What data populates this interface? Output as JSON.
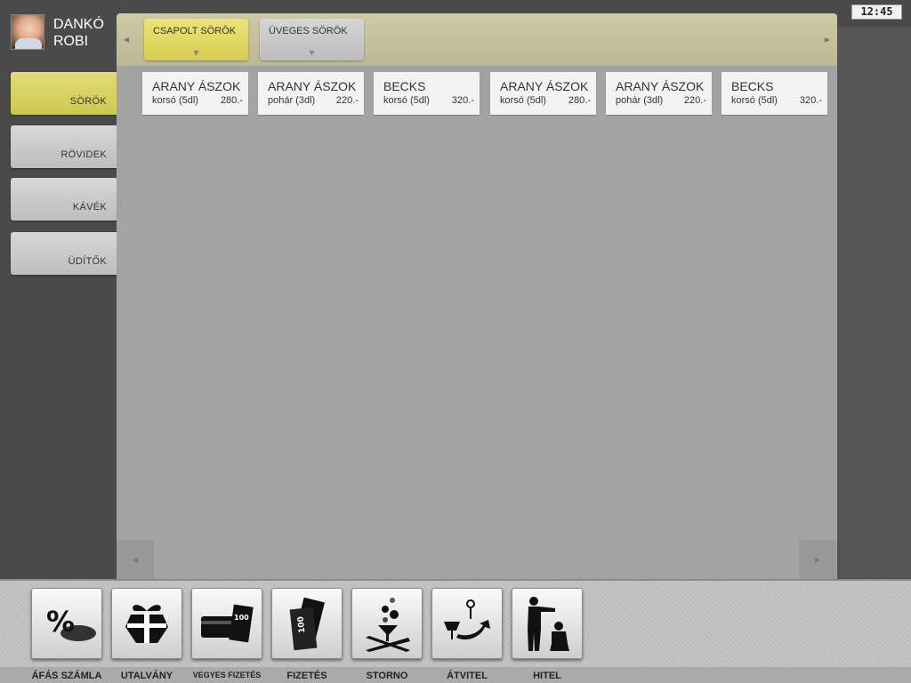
{
  "user": {
    "name_line1": "DANKÓ",
    "name_line2": "ROBI"
  },
  "clock": {
    "time": "12:45"
  },
  "categories": [
    {
      "label": "SÖRÖK",
      "active": true
    },
    {
      "label": "RÖVIDEK",
      "active": false
    },
    {
      "label": "KÁVÉK",
      "active": false
    },
    {
      "label": "ÜDÍTŐK",
      "active": false
    }
  ],
  "sub_tabs": [
    {
      "label": "CSAPOLT SÖRÖK",
      "active": true
    },
    {
      "label": "ÜVEGES SÖRÖK",
      "active": false
    }
  ],
  "products": [
    {
      "name": "ARANY ÁSZOK",
      "size": "korsó (5dl)",
      "price": "280.-"
    },
    {
      "name": "ARANY ÁSZOK",
      "size": "pohár (3dl)",
      "price": "220.-"
    },
    {
      "name": "BECKS",
      "size": "korsó (5dl)",
      "price": "320.-"
    },
    {
      "name": "ARANY ÁSZOK",
      "size": "korsó (5dl)",
      "price": "280.-"
    },
    {
      "name": "ARANY ÁSZOK",
      "size": "pohár (3dl)",
      "price": "220.-"
    },
    {
      "name": "BECKS",
      "size": "korsó (5dl)",
      "price": "320.-"
    }
  ],
  "actions": [
    {
      "label": "ÁFÁS SZÁMLA",
      "icon": "percent-icon"
    },
    {
      "label": "UTALVÁNY",
      "icon": "gift-icon"
    },
    {
      "label": "VEGYES FIZETÉS",
      "icon": "mixed-payment-icon"
    },
    {
      "label": "FIZETÉS",
      "icon": "banknotes-icon"
    },
    {
      "label": "STORNO",
      "icon": "storno-icon"
    },
    {
      "label": "ÁTVITEL",
      "icon": "transfer-icon"
    },
    {
      "label": "HITEL",
      "icon": "credit-icon"
    }
  ],
  "icon_texts": {
    "banknote_value": "100"
  },
  "colors": {
    "accent": "#d6cd52",
    "panel": "#a3a3a3",
    "header": "#c5c09c",
    "background": "#4a4a4a"
  }
}
